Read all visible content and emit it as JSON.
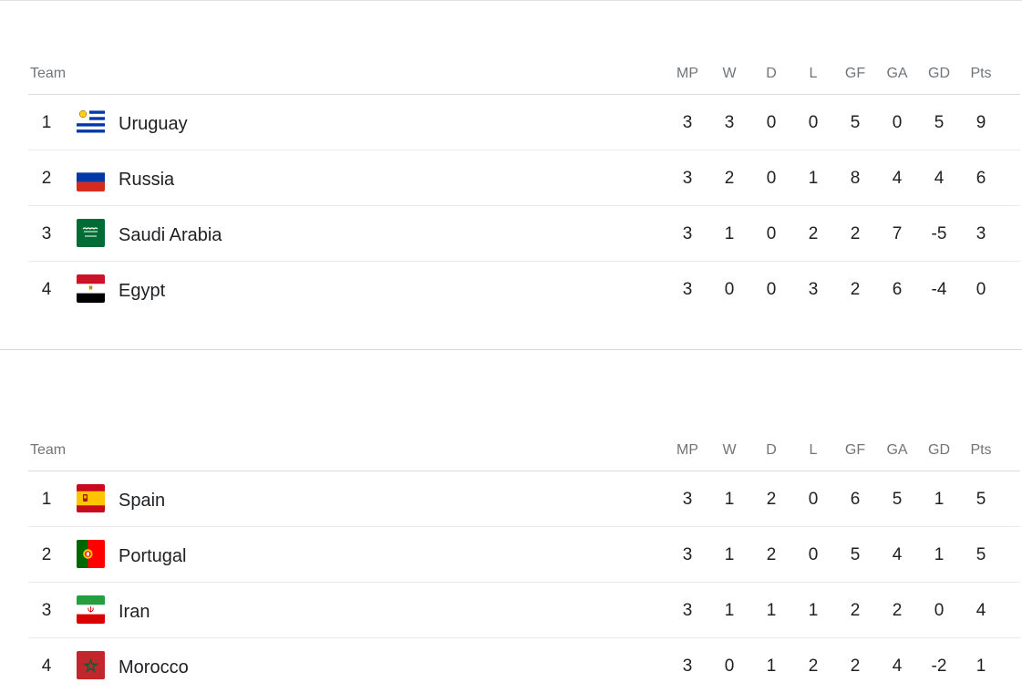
{
  "columns": [
    "MP",
    "W",
    "D",
    "L",
    "GF",
    "GA",
    "GD",
    "Pts"
  ],
  "groups": [
    {
      "team_header": "Team",
      "rows": [
        {
          "rank": "1",
          "team": "Uruguay",
          "flag": "uruguay-flag-icon",
          "stats": [
            "3",
            "3",
            "0",
            "0",
            "5",
            "0",
            "5",
            "9"
          ]
        },
        {
          "rank": "2",
          "team": "Russia",
          "flag": "russia-flag-icon",
          "stats": [
            "3",
            "2",
            "0",
            "1",
            "8",
            "4",
            "4",
            "6"
          ]
        },
        {
          "rank": "3",
          "team": "Saudi Arabia",
          "flag": "saudi-arabia-flag-icon",
          "stats": [
            "3",
            "1",
            "0",
            "2",
            "2",
            "7",
            "-5",
            "3"
          ]
        },
        {
          "rank": "4",
          "team": "Egypt",
          "flag": "egypt-flag-icon",
          "stats": [
            "3",
            "0",
            "0",
            "3",
            "2",
            "6",
            "-4",
            "0"
          ]
        }
      ]
    },
    {
      "team_header": "Team",
      "rows": [
        {
          "rank": "1",
          "team": "Spain",
          "flag": "spain-flag-icon",
          "stats": [
            "3",
            "1",
            "2",
            "0",
            "6",
            "5",
            "1",
            "5"
          ]
        },
        {
          "rank": "2",
          "team": "Portugal",
          "flag": "portugal-flag-icon",
          "stats": [
            "3",
            "1",
            "2",
            "0",
            "5",
            "4",
            "1",
            "5"
          ]
        },
        {
          "rank": "3",
          "team": "Iran",
          "flag": "iran-flag-icon",
          "stats": [
            "3",
            "1",
            "1",
            "1",
            "2",
            "2",
            "0",
            "4"
          ]
        },
        {
          "rank": "4",
          "team": "Morocco",
          "flag": "morocco-flag-icon",
          "stats": [
            "3",
            "0",
            "1",
            "2",
            "2",
            "4",
            "-2",
            "1"
          ]
        }
      ]
    }
  ],
  "colors": {
    "text": "#202124",
    "header_text": "#70757a",
    "row_divider": "#e8eaed",
    "group_divider": "#d6d6d6"
  }
}
